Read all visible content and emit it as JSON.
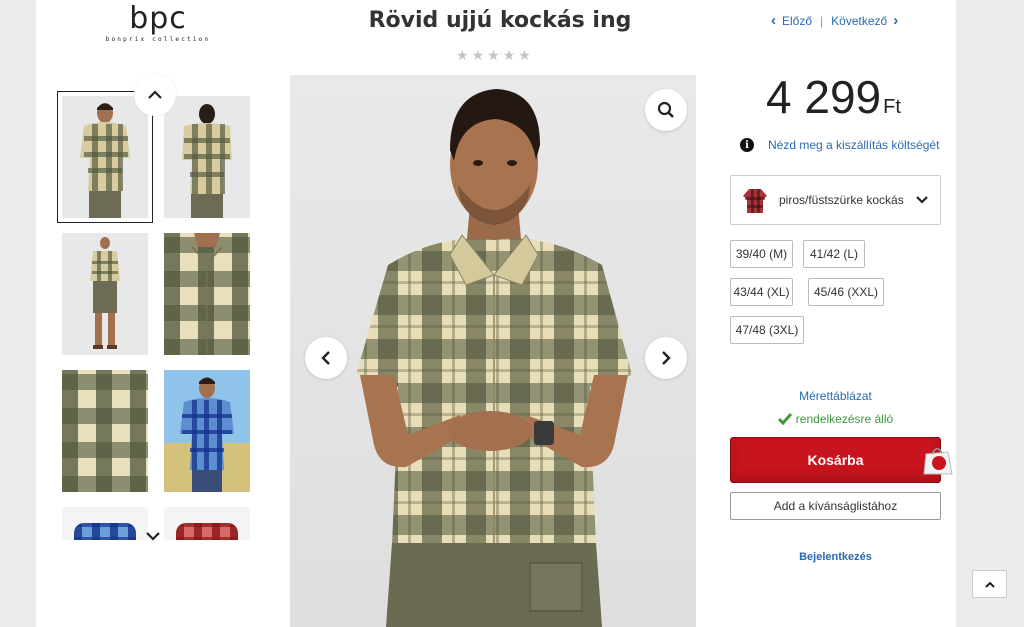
{
  "logo": {
    "main": "bpc",
    "sub": "bonprix collection"
  },
  "product": {
    "title": "Rövid ujjú kockás ing",
    "rating_stars": 0,
    "rating_max": 5
  },
  "nav": {
    "prev": "Előző",
    "next": "Következő",
    "separator": "|"
  },
  "price": {
    "amount": "4 299",
    "currency": "Ft"
  },
  "shipping": {
    "info": "i",
    "link": "Nézd meg a kiszállítás költségét"
  },
  "color": {
    "selected": "piros/füstszürke kockás",
    "swatch": "#a8323a"
  },
  "sizes": [
    "39/40 (M)",
    "41/42 (L)",
    "43/44 (XL)",
    "45/46 (XXL)",
    "47/48 (3XL)"
  ],
  "size_chart": "Mérettáblázat",
  "availability": "rendelkezésre álló",
  "actions": {
    "cart": "Kosárba",
    "wishlist": "Add a kívánságlistához",
    "login": "Bejelentkezés"
  },
  "colors": {
    "accent_red": "#c8141e",
    "link_blue": "#2a6ab0",
    "available_green": "#3b9a3b"
  },
  "icons": [
    "chevron-up-icon",
    "chevron-down-icon",
    "chevron-left-icon",
    "chevron-right-icon",
    "zoom-icon",
    "info-icon",
    "checkmark-icon",
    "shopping-bag-icon",
    "back-to-top-icon",
    "star-icon"
  ]
}
